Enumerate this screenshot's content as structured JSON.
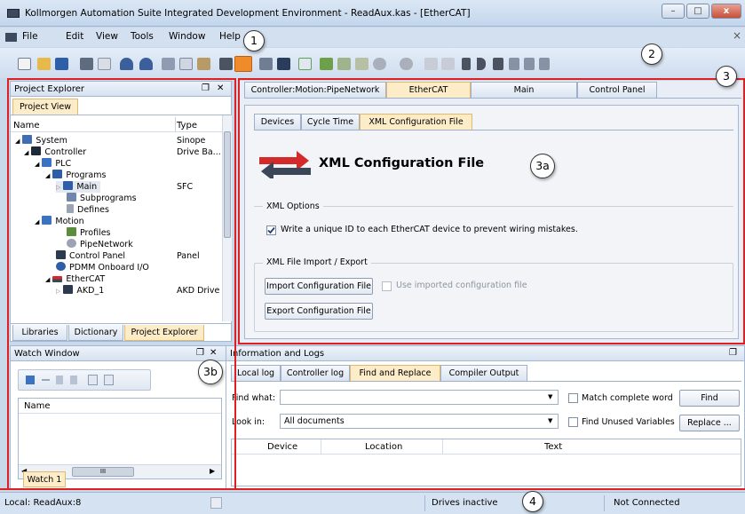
{
  "window": {
    "title": "Kollmorgen Automation Suite Integrated Development Environment - ReadAux.kas - [EtherCAT]",
    "min_glyph": "–",
    "max_glyph": "□",
    "close_glyph": "x"
  },
  "menu": [
    "File",
    "Edit",
    "View",
    "Tools",
    "Window",
    "Help"
  ],
  "mdi_close_glyph": "×",
  "callouts": [
    "1",
    "2",
    "3",
    "3a",
    "3b",
    "4"
  ],
  "project_explorer": {
    "title": "Project Explorer",
    "pin_glyph": "❐",
    "close_glyph": "✕",
    "view_tab": "Project View",
    "col_name": "Name",
    "col_type": "Type",
    "items": [
      {
        "label": "System",
        "type": "Sinope",
        "icon": "system-icon"
      },
      {
        "label": "Controller",
        "type": "Drive Ba...",
        "icon": "controller-icon"
      },
      {
        "label": "PLC",
        "type": "",
        "icon": "plc-icon"
      },
      {
        "label": "Programs",
        "type": "",
        "icon": "programs-icon"
      },
      {
        "label": "Main",
        "type": "SFC",
        "icon": "program-icon"
      },
      {
        "label": "Subprograms",
        "type": "",
        "icon": "subprograms-icon"
      },
      {
        "label": "Defines",
        "type": "",
        "icon": "defines-icon"
      },
      {
        "label": "Motion",
        "type": "",
        "icon": "motion-icon"
      },
      {
        "label": "Profiles",
        "type": "",
        "icon": "profiles-icon"
      },
      {
        "label": "PipeNetwork",
        "type": "",
        "icon": "pipenetwork-icon"
      },
      {
        "label": "Control Panel",
        "type": "Panel",
        "icon": "control-panel-icon"
      },
      {
        "label": "PDMM Onboard I/O",
        "type": "",
        "icon": "io-icon"
      },
      {
        "label": "EtherCAT",
        "type": "",
        "icon": "ethercat-icon"
      },
      {
        "label": "AKD_1",
        "type": "AKD Drive",
        "icon": "drive-icon"
      }
    ],
    "bottom_tabs": [
      "Libraries",
      "Dictionary",
      "Project Explorer"
    ]
  },
  "editor": {
    "doc_tabs": [
      "Controller:Motion:PipeNetwork",
      "EtherCAT",
      "Main",
      "Control Panel"
    ],
    "sub_tabs": [
      "Devices",
      "Cycle Time",
      "XML Configuration File"
    ],
    "heading": "XML Configuration File",
    "xml_options": {
      "title": "XML Options",
      "unique_id_label": "Write a unique ID to each EtherCAT device to prevent wiring mistakes.",
      "unique_id_checked": true
    },
    "import_export": {
      "title": "XML File Import / Export",
      "import_button": "Import Configuration File",
      "use_imported_label": "Use imported configuration file",
      "use_imported_checked": false,
      "export_button": "Export Configuration File"
    }
  },
  "watch": {
    "title": "Watch Window",
    "col_name": "Name",
    "scroll_glyph": "III",
    "tab": "Watch 1"
  },
  "logs": {
    "title": "Information and Logs",
    "tabs": [
      "Local log",
      "Controller log",
      "Find and Replace",
      "Compiler Output"
    ],
    "find_label": "Find what:",
    "find_value": "",
    "match_label": "Match complete word",
    "find_button": "Find",
    "lookin_label": "Look in:",
    "lookin_value": "All documents",
    "unused_label": "Find Unused Variables",
    "replace_button": "Replace ...",
    "columns": [
      "Device",
      "Location",
      "Text"
    ]
  },
  "status": {
    "local": "Local: ReadAux:8",
    "drives": "Drives inactive",
    "connection": "Not Connected"
  },
  "colors": {
    "highlight_red": "#e02020",
    "selected_tab": "#fdecc8",
    "chrome_blue": "#d3e0f0"
  }
}
